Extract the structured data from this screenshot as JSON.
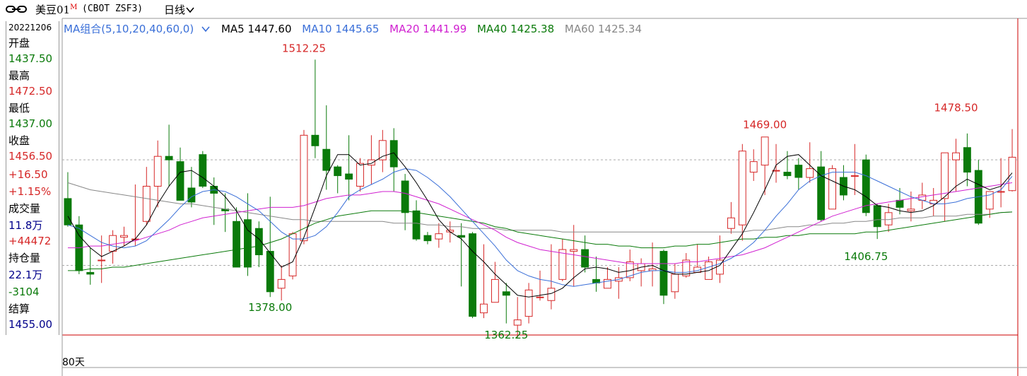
{
  "header": {
    "symbol": "美豆01",
    "symbol_mark": "M",
    "code": "(CBOT ZSF3)",
    "period": "日线"
  },
  "info_panel": {
    "date": "20221206",
    "open_label": "开盘",
    "open": "1437.50",
    "high_label": "最高",
    "high": "1472.50",
    "low_label": "最低",
    "low": "1437.00",
    "close_label": "收盘",
    "close": "1456.50",
    "change": "+16.50",
    "change_pct": "+1.15%",
    "volume_label": "成交量",
    "volume": "11.8万",
    "volume_change": "+44472",
    "oi_label": "持仓量",
    "oi": "22.1万",
    "oi_change": "-3104",
    "settle_label": "结算",
    "settle": "1455.00"
  },
  "ma_bar": {
    "group": "MA组合(5,10,20,40,60,0)",
    "ma5": "MA5 1447.60",
    "ma10": "MA10 1445.65",
    "ma20": "MA20 1441.99",
    "ma40": "MA40 1425.38",
    "ma60": "MA60 1425.34"
  },
  "footer": {
    "days": "80天"
  },
  "colors": {
    "up": "#d62828",
    "down": "#0a7a0a",
    "ma5": "#000000",
    "ma10": "#3a6fd8",
    "ma20": "#d020d0",
    "ma40": "#0a7a0a",
    "ma60": "#888888"
  },
  "chart_data": {
    "type": "candlestick",
    "ylim": [
      1355,
      1525
    ],
    "annotations": [
      {
        "index": 21,
        "label": "1512.25",
        "value": 1512.25,
        "kind": "high"
      },
      {
        "index": 18,
        "label": "1378.00",
        "value": 1378.0,
        "kind": "low"
      },
      {
        "index": 39,
        "label": "1362.25",
        "value": 1362.25,
        "kind": "low"
      },
      {
        "index": 62,
        "label": "1469.00",
        "value": 1469.0,
        "kind": "high"
      },
      {
        "index": 71,
        "label": "1406.75",
        "value": 1406.75,
        "kind": "low"
      },
      {
        "index": 79,
        "label": "1478.50",
        "value": 1478.5,
        "kind": "high"
      }
    ],
    "candles": [
      [
        1433.0,
        1448.0,
        1418.0,
        1417.0
      ],
      [
        1418.0,
        1423.0,
        1392.0,
        1390.0
      ],
      [
        1391.0,
        1405.0,
        1390.0,
        1384.0
      ],
      [
        1398.0,
        1412.0,
        1398.0,
        1385.0
      ],
      [
        1403.0,
        1415.0,
        1412.0,
        1396.0
      ],
      [
        1411.0,
        1417.0,
        1412.0,
        1406.0
      ],
      [
        1410.0,
        1441.0,
        1410.0,
        1406.0
      ],
      [
        1420.0,
        1451.0,
        1440.0,
        1418.0
      ],
      [
        1440.0,
        1466.0,
        1457.0,
        1428.0
      ],
      [
        1457.0,
        1475.0,
        1455.0,
        1440.0
      ],
      [
        1454.0,
        1462.0,
        1432.0,
        1432.0
      ],
      [
        1439.0,
        1451.0,
        1431.0,
        1428.0
      ],
      [
        1458.0,
        1460.0,
        1440.0,
        1439.0
      ],
      [
        1440.0,
        1445.0,
        1436.0,
        1418.0
      ],
      [
        1427.0,
        1436.0,
        1426.0,
        1414.0
      ],
      [
        1420.0,
        1428.0,
        1394.0,
        1394.0
      ],
      [
        1421.0,
        1436.0,
        1394.0,
        1389.0
      ],
      [
        1416.0,
        1420.0,
        1401.0,
        1394.0
      ],
      [
        1403.0,
        1434.0,
        1380.0,
        1377.0
      ],
      [
        1382.0,
        1395.0,
        1387.0,
        1375.0
      ],
      [
        1389.0,
        1414.0,
        1413.0,
        1387.0
      ],
      [
        1409.0,
        1472.0,
        1469.0,
        1407.0
      ],
      [
        1469.0,
        1512.0,
        1463.0,
        1456.0
      ],
      [
        1461.0,
        1486.0,
        1449.0,
        1438.0
      ],
      [
        1451.0,
        1452.0,
        1446.0,
        1436.0
      ],
      [
        1447.0,
        1469.0,
        1444.0,
        1432.0
      ],
      [
        1440.0,
        1456.0,
        1453.0,
        1437.0
      ],
      [
        1452.0,
        1469.0,
        1455.0,
        1441.0
      ],
      [
        1455.0,
        1472.0,
        1466.0,
        1448.0
      ],
      [
        1466.0,
        1473.0,
        1451.0,
        1437.0
      ],
      [
        1443.0,
        1447.0,
        1425.0,
        1415.0
      ],
      [
        1426.0,
        1432.0,
        1410.0,
        1409.0
      ],
      [
        1412.0,
        1414.0,
        1409.0,
        1407.0
      ],
      [
        1410.0,
        1419.0,
        1413.0,
        1405.0
      ],
      [
        1414.0,
        1420.0,
        1415.0,
        1408.0
      ],
      [
        1412.0,
        1419.0,
        1411.0,
        1383.0
      ],
      [
        1413.0,
        1414.0,
        1366.0,
        1365.0
      ],
      [
        1368.0,
        1407.0,
        1373.0,
        1365.0
      ],
      [
        1374.0,
        1397.0,
        1387.0,
        1375.0
      ],
      [
        1380.0,
        1385.0,
        1378.0,
        1362.0
      ],
      [
        1361.0,
        1377.0,
        1364.0,
        1354.0
      ],
      [
        1366.0,
        1385.0,
        1381.0,
        1362.0
      ],
      [
        1377.0,
        1392.0,
        1377.0,
        1375.0
      ],
      [
        1375.0,
        1407.0,
        1382.0,
        1370.0
      ],
      [
        1387.0,
        1410.0,
        1404.0,
        1386.0
      ],
      [
        1403.0,
        1418.0,
        1404.0,
        1383.0
      ],
      [
        1404.0,
        1412.0,
        1394.0,
        1391.0
      ],
      [
        1387.0,
        1400.0,
        1385.0,
        1380.0
      ],
      [
        1382.0,
        1394.0,
        1387.0,
        1382.0
      ],
      [
        1386.0,
        1394.0,
        1388.0,
        1376.0
      ],
      [
        1388.0,
        1404.0,
        1397.0,
        1386.0
      ],
      [
        1392.0,
        1399.0,
        1396.0,
        1383.0
      ],
      [
        1392.0,
        1408.0,
        1393.0,
        1383.0
      ],
      [
        1403.0,
        1404.0,
        1378.0,
        1373.0
      ],
      [
        1380.0,
        1396.0,
        1390.0,
        1376.0
      ],
      [
        1389.0,
        1402.0,
        1398.0,
        1388.0
      ],
      [
        1391.0,
        1407.0,
        1394.0,
        1391.0
      ],
      [
        1387.0,
        1400.0,
        1397.0,
        1387.0
      ],
      [
        1390.0,
        1412.0,
        1398.0,
        1385.0
      ],
      [
        1416.0,
        1431.0,
        1422.0,
        1413.0
      ],
      [
        1418.0,
        1464.0,
        1460.0,
        1409.0
      ],
      [
        1448.0,
        1461.0,
        1454.0,
        1443.0
      ],
      [
        1452.0,
        1468.0,
        1468.0,
        1435.0
      ],
      [
        1449.0,
        1464.0,
        1449.0,
        1442.0
      ],
      [
        1448.0,
        1460.0,
        1446.0,
        1444.0
      ],
      [
        1452.0,
        1456.0,
        1445.0,
        1438.0
      ],
      [
        1445.0,
        1465.0,
        1450.0,
        1442.0
      ],
      [
        1451.0,
        1460.0,
        1421.0,
        1420.0
      ],
      [
        1427.0,
        1452.0,
        1450.0,
        1427.0
      ],
      [
        1445.0,
        1452.0,
        1435.0,
        1432.0
      ],
      [
        1446.0,
        1464.0,
        1446.0,
        1435.0
      ],
      [
        1455.0,
        1458.0,
        1425.0,
        1423.0
      ],
      [
        1429.0,
        1430.0,
        1417.0,
        1410.0
      ],
      [
        1418.0,
        1430.0,
        1425.0,
        1414.0
      ],
      [
        1432.0,
        1439.0,
        1428.0,
        1424.0
      ],
      [
        1426.0,
        1437.0,
        1427.0,
        1420.0
      ],
      [
        1432.0,
        1442.0,
        1435.0,
        1427.0
      ],
      [
        1430.0,
        1439.0,
        1432.0,
        1423.0
      ],
      [
        1433.0,
        1452.0,
        1459.0,
        1420.0
      ],
      [
        1455.0,
        1467.0,
        1459.0,
        1437.0
      ],
      [
        1462.0,
        1470.0,
        1448.0,
        1440.0
      ],
      [
        1449.0,
        1455.0,
        1419.0,
        1418.0
      ],
      [
        1427.0,
        1436.0,
        1437.0,
        1422.0
      ],
      [
        1437.0,
        1456.0,
        1437.0,
        1428.0
      ],
      [
        1437.5,
        1472.5,
        1456.5,
        1437.0
      ]
    ],
    "ma5": [
      1423,
      1412,
      1405,
      1400,
      1403,
      1406,
      1410,
      1418,
      1430,
      1440,
      1448,
      1449,
      1445,
      1440,
      1434,
      1426,
      1415,
      1410,
      1402,
      1394,
      1397,
      1411,
      1428,
      1446,
      1458,
      1458,
      1452,
      1453,
      1457,
      1459,
      1451,
      1442,
      1432,
      1421,
      1414,
      1410,
      1403,
      1397,
      1390,
      1384,
      1378,
      1377,
      1378,
      1379,
      1382,
      1388,
      1393,
      1394,
      1393,
      1391,
      1392,
      1394,
      1395,
      1392,
      1390,
      1390,
      1391,
      1392,
      1395,
      1404,
      1413,
      1425,
      1438,
      1452,
      1457,
      1458,
      1452,
      1446,
      1443,
      1440,
      1438,
      1434,
      1429,
      1428,
      1426,
      1425,
      1426,
      1429,
      1434,
      1440,
      1444,
      1441,
      1438,
      1440,
      1447.6
    ],
    "ma10": [
      1418,
      1416,
      1412,
      1408,
      1406,
      1405,
      1406,
      1409,
      1415,
      1421,
      1428,
      1434,
      1437,
      1438,
      1437,
      1434,
      1430,
      1426,
      1420,
      1414,
      1410,
      1410,
      1412,
      1417,
      1425,
      1434,
      1438,
      1441,
      1444,
      1448,
      1450,
      1449,
      1445,
      1440,
      1434,
      1427,
      1420,
      1413,
      1406,
      1398,
      1392,
      1389,
      1387,
      1386,
      1384,
      1383,
      1384,
      1385,
      1386,
      1387,
      1389,
      1391,
      1392,
      1392,
      1391,
      1391,
      1392,
      1394,
      1396,
      1399,
      1403,
      1408,
      1415,
      1423,
      1430,
      1438,
      1443,
      1446,
      1448,
      1448,
      1448,
      1446,
      1443,
      1440,
      1437,
      1434,
      1432,
      1430,
      1430,
      1431,
      1433,
      1434,
      1435,
      1438,
      1445.65
    ],
    "ma20": [
      1405,
      1405,
      1406,
      1406,
      1407,
      1408,
      1409,
      1411,
      1413,
      1415,
      1418,
      1420,
      1422,
      1423,
      1424,
      1425,
      1426,
      1427,
      1428,
      1428,
      1428,
      1429,
      1431,
      1433,
      1434,
      1435,
      1435,
      1436,
      1437,
      1437,
      1436,
      1434,
      1432,
      1430,
      1427,
      1424,
      1421,
      1418,
      1415,
      1411,
      1408,
      1406,
      1404,
      1403,
      1402,
      1401,
      1400,
      1399,
      1398,
      1397,
      1396,
      1396,
      1396,
      1396,
      1396,
      1397,
      1397,
      1398,
      1399,
      1400,
      1401,
      1403,
      1405,
      1408,
      1411,
      1414,
      1417,
      1420,
      1423,
      1425,
      1427,
      1429,
      1430,
      1431,
      1432,
      1433,
      1434,
      1435,
      1436,
      1437,
      1438,
      1439,
      1440,
      1441,
      1441.99
    ],
    "ma40": [
      1392,
      1392,
      1393,
      1393,
      1394,
      1394,
      1395,
      1396,
      1397,
      1398,
      1399,
      1400,
      1401,
      1402,
      1403,
      1404,
      1405,
      1406,
      1408,
      1410,
      1413,
      1416,
      1419,
      1421,
      1423,
      1424,
      1425,
      1426,
      1426,
      1426,
      1426,
      1425,
      1424,
      1423,
      1422,
      1421,
      1420,
      1419,
      1417,
      1416,
      1414,
      1413,
      1412,
      1411,
      1410,
      1409,
      1408,
      1407,
      1407,
      1406,
      1406,
      1405,
      1405,
      1405,
      1406,
      1406,
      1407,
      1407,
      1408,
      1409,
      1410,
      1410,
      1411,
      1411,
      1412,
      1412,
      1413,
      1413,
      1413,
      1413,
      1413,
      1414,
      1414,
      1415,
      1416,
      1417,
      1418,
      1419,
      1420,
      1421,
      1422,
      1423,
      1424,
      1425,
      1425.38
    ],
    "ma60": [
      1442,
      1440,
      1438,
      1437,
      1436,
      1435,
      1434,
      1433,
      1432,
      1431,
      1430,
      1430,
      1429,
      1428,
      1427,
      1426,
      1425,
      1424,
      1423,
      1422,
      1421,
      1421,
      1420,
      1420,
      1420,
      1420,
      1420,
      1420,
      1420,
      1419,
      1419,
      1419,
      1418,
      1418,
      1417,
      1417,
      1416,
      1416,
      1416,
      1415,
      1415,
      1415,
      1415,
      1415,
      1414,
      1414,
      1414,
      1414,
      1414,
      1414,
      1414,
      1414,
      1414,
      1414,
      1414,
      1414,
      1414,
      1414,
      1414,
      1414,
      1414,
      1415,
      1415,
      1416,
      1417,
      1417,
      1418,
      1418,
      1419,
      1419,
      1420,
      1420,
      1421,
      1421,
      1422,
      1422,
      1422,
      1423,
      1423,
      1423,
      1424,
      1424,
      1424,
      1425,
      1425.34
    ]
  }
}
